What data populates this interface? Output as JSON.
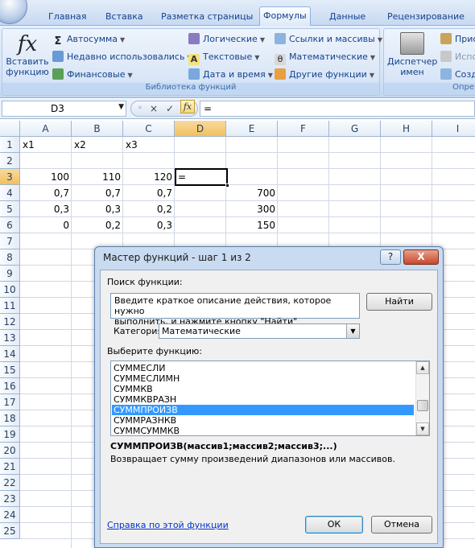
{
  "ribbon": {
    "tabs": [
      "Главная",
      "Вставка",
      "Разметка страницы",
      "Формулы",
      "Данные",
      "Рецензирование"
    ],
    "active_tab": "Формулы",
    "insert_function": {
      "line1": "Вставить",
      "line2": "функцию"
    },
    "lib_col1": [
      "Автосумма",
      "Недавно использовались",
      "Финансовые"
    ],
    "lib_col2": [
      "Логические",
      "Текстовые",
      "Дата и время"
    ],
    "lib_col3": [
      "Ссылки и массивы",
      "Математические",
      "Другие функции"
    ],
    "library_label": "Библиотека функций",
    "name_manager": {
      "line1": "Диспетчер",
      "line2": "имен"
    },
    "names_group": [
      "Прис",
      "Испо",
      "Созд"
    ],
    "names_label": "Опре"
  },
  "formula_bar": {
    "name_box": "D3",
    "cancel_icon": "×",
    "enter_icon": "✓",
    "fx_label": "fx",
    "formula": "="
  },
  "sheet": {
    "columns": [
      "A",
      "B",
      "C",
      "D",
      "E",
      "F",
      "G",
      "H",
      "I"
    ],
    "selected_column": "D",
    "rows": [
      "1",
      "2",
      "3",
      "4",
      "5",
      "6",
      "7",
      "8",
      "9",
      "10",
      "11",
      "12",
      "13",
      "14",
      "15",
      "16",
      "17",
      "18",
      "19",
      "20",
      "21",
      "22",
      "23",
      "24",
      "25"
    ],
    "selected_row": "3",
    "cells": {
      "A1": "x1",
      "B1": "x2",
      "C1": "x3",
      "A3": "100",
      "B3": "110",
      "C3": "120",
      "D3": "=",
      "A4": "0,7",
      "B4": "0,7",
      "C4": "0,7",
      "E4": "700",
      "A5": "0,3",
      "B5": "0,3",
      "C5": "0,2",
      "E5": "300",
      "A6": "0",
      "B6": "0,2",
      "C6": "0,3",
      "E6": "150"
    }
  },
  "dialog": {
    "title": "Мастер функций - шаг 1 из 2",
    "help_btn": "?",
    "close_btn": "X",
    "search_label": "Поиск функции:",
    "search_text": "Введите краткое описание действия, которое нужно\nвыполнить, и нажмите кнопку \"Найти\"",
    "find_button": "Найти",
    "category_label": "Категория:",
    "category_value": "Математические",
    "choose_label": "Выберите функцию:",
    "functions": [
      "СУММЕСЛИ",
      "СУММЕСЛИМН",
      "СУММКВ",
      "СУММКВРАЗН",
      "СУММПРОИЗВ",
      "СУММРАЗНКВ",
      "СУММСУММКВ"
    ],
    "selected_function": "СУММПРОИЗВ",
    "syntax": "СУММПРОИЗВ(массив1;массив2;массив3;...)",
    "description": "Возвращает сумму произведений диапазонов или массивов.",
    "help_link": "Справка по этой функции",
    "ok": "ОК",
    "cancel": "Отмена"
  },
  "colors": {
    "ribbon_blue": "#d4e3f6",
    "selection_blue": "#3399ff",
    "header_highlight": "#f1c15f",
    "link_blue": "#0033cc"
  }
}
